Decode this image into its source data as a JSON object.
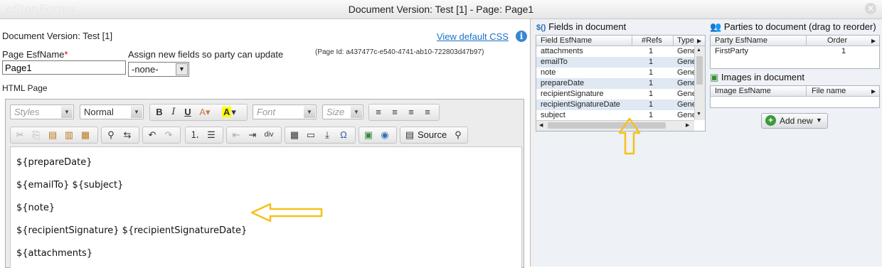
{
  "window": {
    "title": "Document Version: Test [1] - Page: Page1",
    "brand": "eSignForms"
  },
  "left": {
    "doc_version": "Document Version: Test [1]",
    "view_css_link": "View default CSS",
    "page_esfname_label": "Page EsfName",
    "required_mark": "*",
    "page_esfname_value": "Page1",
    "assign_label": "Assign new fields so party can update",
    "assign_select_value": "-none-",
    "page_id": "(Page Id: a437477c-e540-4741-ab10-722803d47b97)",
    "html_page_label": "HTML Page"
  },
  "editor": {
    "styles_combo": "Styles",
    "format_combo": "Normal",
    "font_combo": "Font",
    "size_combo": "Size",
    "source_button": "Source",
    "lines": [
      "${prepareDate}",
      "${emailTo} ${subject}",
      "${note}",
      "${recipientSignature} ${recipientSignatureDate}",
      "${attachments}"
    ]
  },
  "fields_panel": {
    "title": "Fields in document",
    "columns": [
      "Field EsfName",
      "#Refs",
      "Type"
    ],
    "rows": [
      {
        "name": "attachments",
        "refs": "1",
        "type": "Gene"
      },
      {
        "name": "emailTo",
        "refs": "1",
        "type": "Gene"
      },
      {
        "name": "note",
        "refs": "1",
        "type": "Gene"
      },
      {
        "name": "prepareDate",
        "refs": "1",
        "type": "Gene"
      },
      {
        "name": "recipientSignature",
        "refs": "1",
        "type": "Gene"
      },
      {
        "name": "recipientSignatureDate",
        "refs": "1",
        "type": "Gene"
      },
      {
        "name": "subject",
        "refs": "1",
        "type": "Gene"
      }
    ]
  },
  "parties_panel": {
    "title": "Parties to document (drag to reorder)",
    "columns": [
      "Party EsfName",
      "Order"
    ],
    "rows": [
      {
        "name": "FirstParty",
        "order": "1"
      }
    ]
  },
  "images_panel": {
    "title": "Images in document",
    "columns": [
      "Image EsfName",
      "File name"
    ],
    "add_button": "Add new"
  },
  "colors": {
    "link": "#1a73c8",
    "annotation_arrow": "#f5c11a",
    "row_alt": "#dfe8f3"
  }
}
